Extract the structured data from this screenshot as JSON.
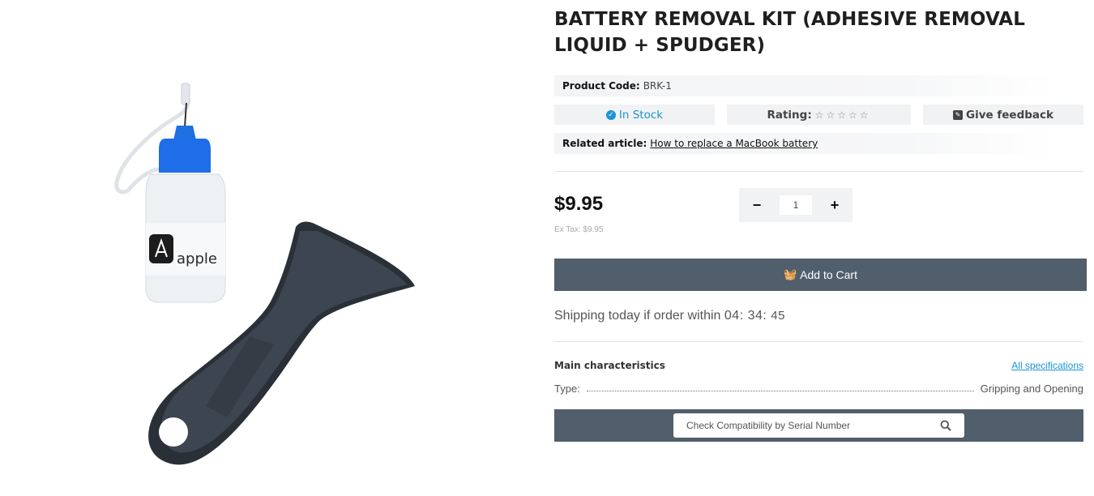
{
  "product": {
    "title": "BATTERY REMOVAL KIT (ADHESIVE REMOVAL LIQUID + SPUDGER)",
    "image_bottle_label": "apple",
    "code_label": "Product Code:",
    "code_value": "BRK-1",
    "stock_label": "In Stock",
    "rating_label": "Rating:",
    "rating_stars": "☆☆☆☆☆",
    "feedback_label": "Give feedback",
    "related_label": "Related article:",
    "related_link": "How to replace a MacBook battery",
    "price": "$9.95",
    "ex_tax": "Ex Tax: $9.95",
    "qty_minus": "−",
    "qty_value": "1",
    "qty_plus": "+",
    "add_to_cart": "Add to Cart",
    "shipping_text": "Shipping today if order within",
    "shipping_hours": "04",
    "shipping_minutes": "34",
    "shipping_seconds": "45"
  },
  "characteristics": {
    "heading": "Main characteristics",
    "all_specs_link": "All specifications",
    "type_label": "Type:",
    "type_value": "Gripping and Opening"
  },
  "compatibility": {
    "placeholder": "Check Compatibility by Serial Number"
  },
  "colors": {
    "accent": "#1a94d6",
    "button": "#515e6b"
  }
}
